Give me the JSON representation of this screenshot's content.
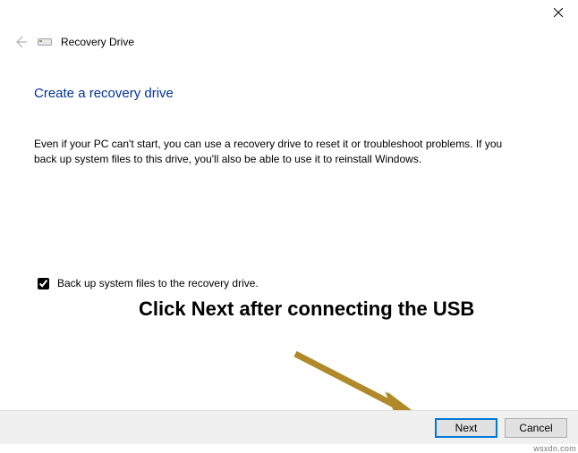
{
  "window": {
    "title": "Recovery Drive"
  },
  "page": {
    "heading": "Create a recovery drive",
    "description": "Even if your PC can't start, you can use a recovery drive to reset it or troubleshoot problems. If you back up system files to this drive, you'll also be able to use it to reinstall Windows."
  },
  "checkbox": {
    "label": "Back up system files to the recovery drive.",
    "checked": true
  },
  "buttons": {
    "next": "Next",
    "cancel": "Cancel"
  },
  "annotation": {
    "text": "Click Next after connecting the USB"
  },
  "watermark": "wsxdn.com"
}
